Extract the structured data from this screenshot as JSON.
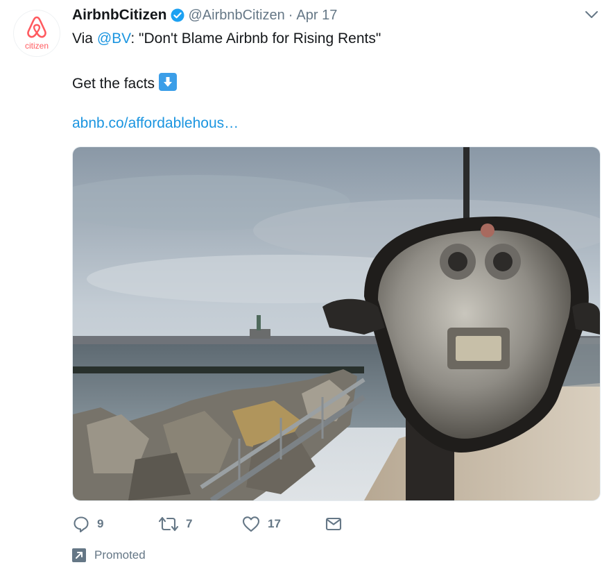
{
  "tweet": {
    "avatar_text": "citizen",
    "display_name": "AirbnbCitizen",
    "handle": "@AirbnbCitizen",
    "separator": "·",
    "date": "Apr 17",
    "line1_prefix": "Via ",
    "line1_mention": "@BV",
    "line1_suffix": ": \"Don't Blame Airbnb for Rising Rents\"",
    "line2": "Get the facts",
    "link_text": "abnb.co/affordablehous…"
  },
  "actions": {
    "replies": "9",
    "retweets": "7",
    "likes": "17"
  },
  "promoted_label": "Promoted",
  "colors": {
    "brand": "#ff5a5f",
    "link": "#1b95e0",
    "muted": "#657786",
    "verified": "#1da1f2"
  },
  "icons": [
    "airbnb-logo-icon",
    "verified-badge-icon",
    "chevron-down-icon",
    "down-arrow-emoji-icon",
    "reply-icon",
    "retweet-icon",
    "like-heart-icon",
    "direct-message-icon",
    "promoted-arrow-icon"
  ]
}
